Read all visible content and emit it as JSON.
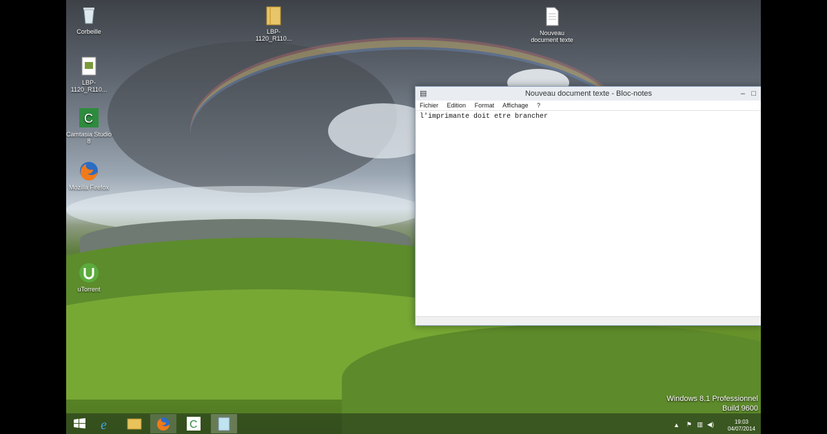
{
  "desktop": {
    "icons": [
      {
        "label": "Corbeille"
      },
      {
        "label": "LBP-1120_R110..."
      },
      {
        "label": "Nouveau document texte"
      },
      {
        "label": "LBP-1120_R110..."
      },
      {
        "label": "Camtasia Studio 8"
      },
      {
        "label": "Mozilla Firefox"
      },
      {
        "label": "uTorrent"
      }
    ]
  },
  "notepad": {
    "title": "Nouveau document texte - Bloc-notes",
    "menu": [
      "Fichier",
      "Edition",
      "Format",
      "Affichage",
      "?"
    ],
    "content": "l'imprimante doit etre brancher"
  },
  "watermark": {
    "line1": "Windows 8.1 Professionnel",
    "line2": "Build 9600"
  },
  "taskbar": {
    "time": "19:03",
    "date": "04/07/2014"
  }
}
